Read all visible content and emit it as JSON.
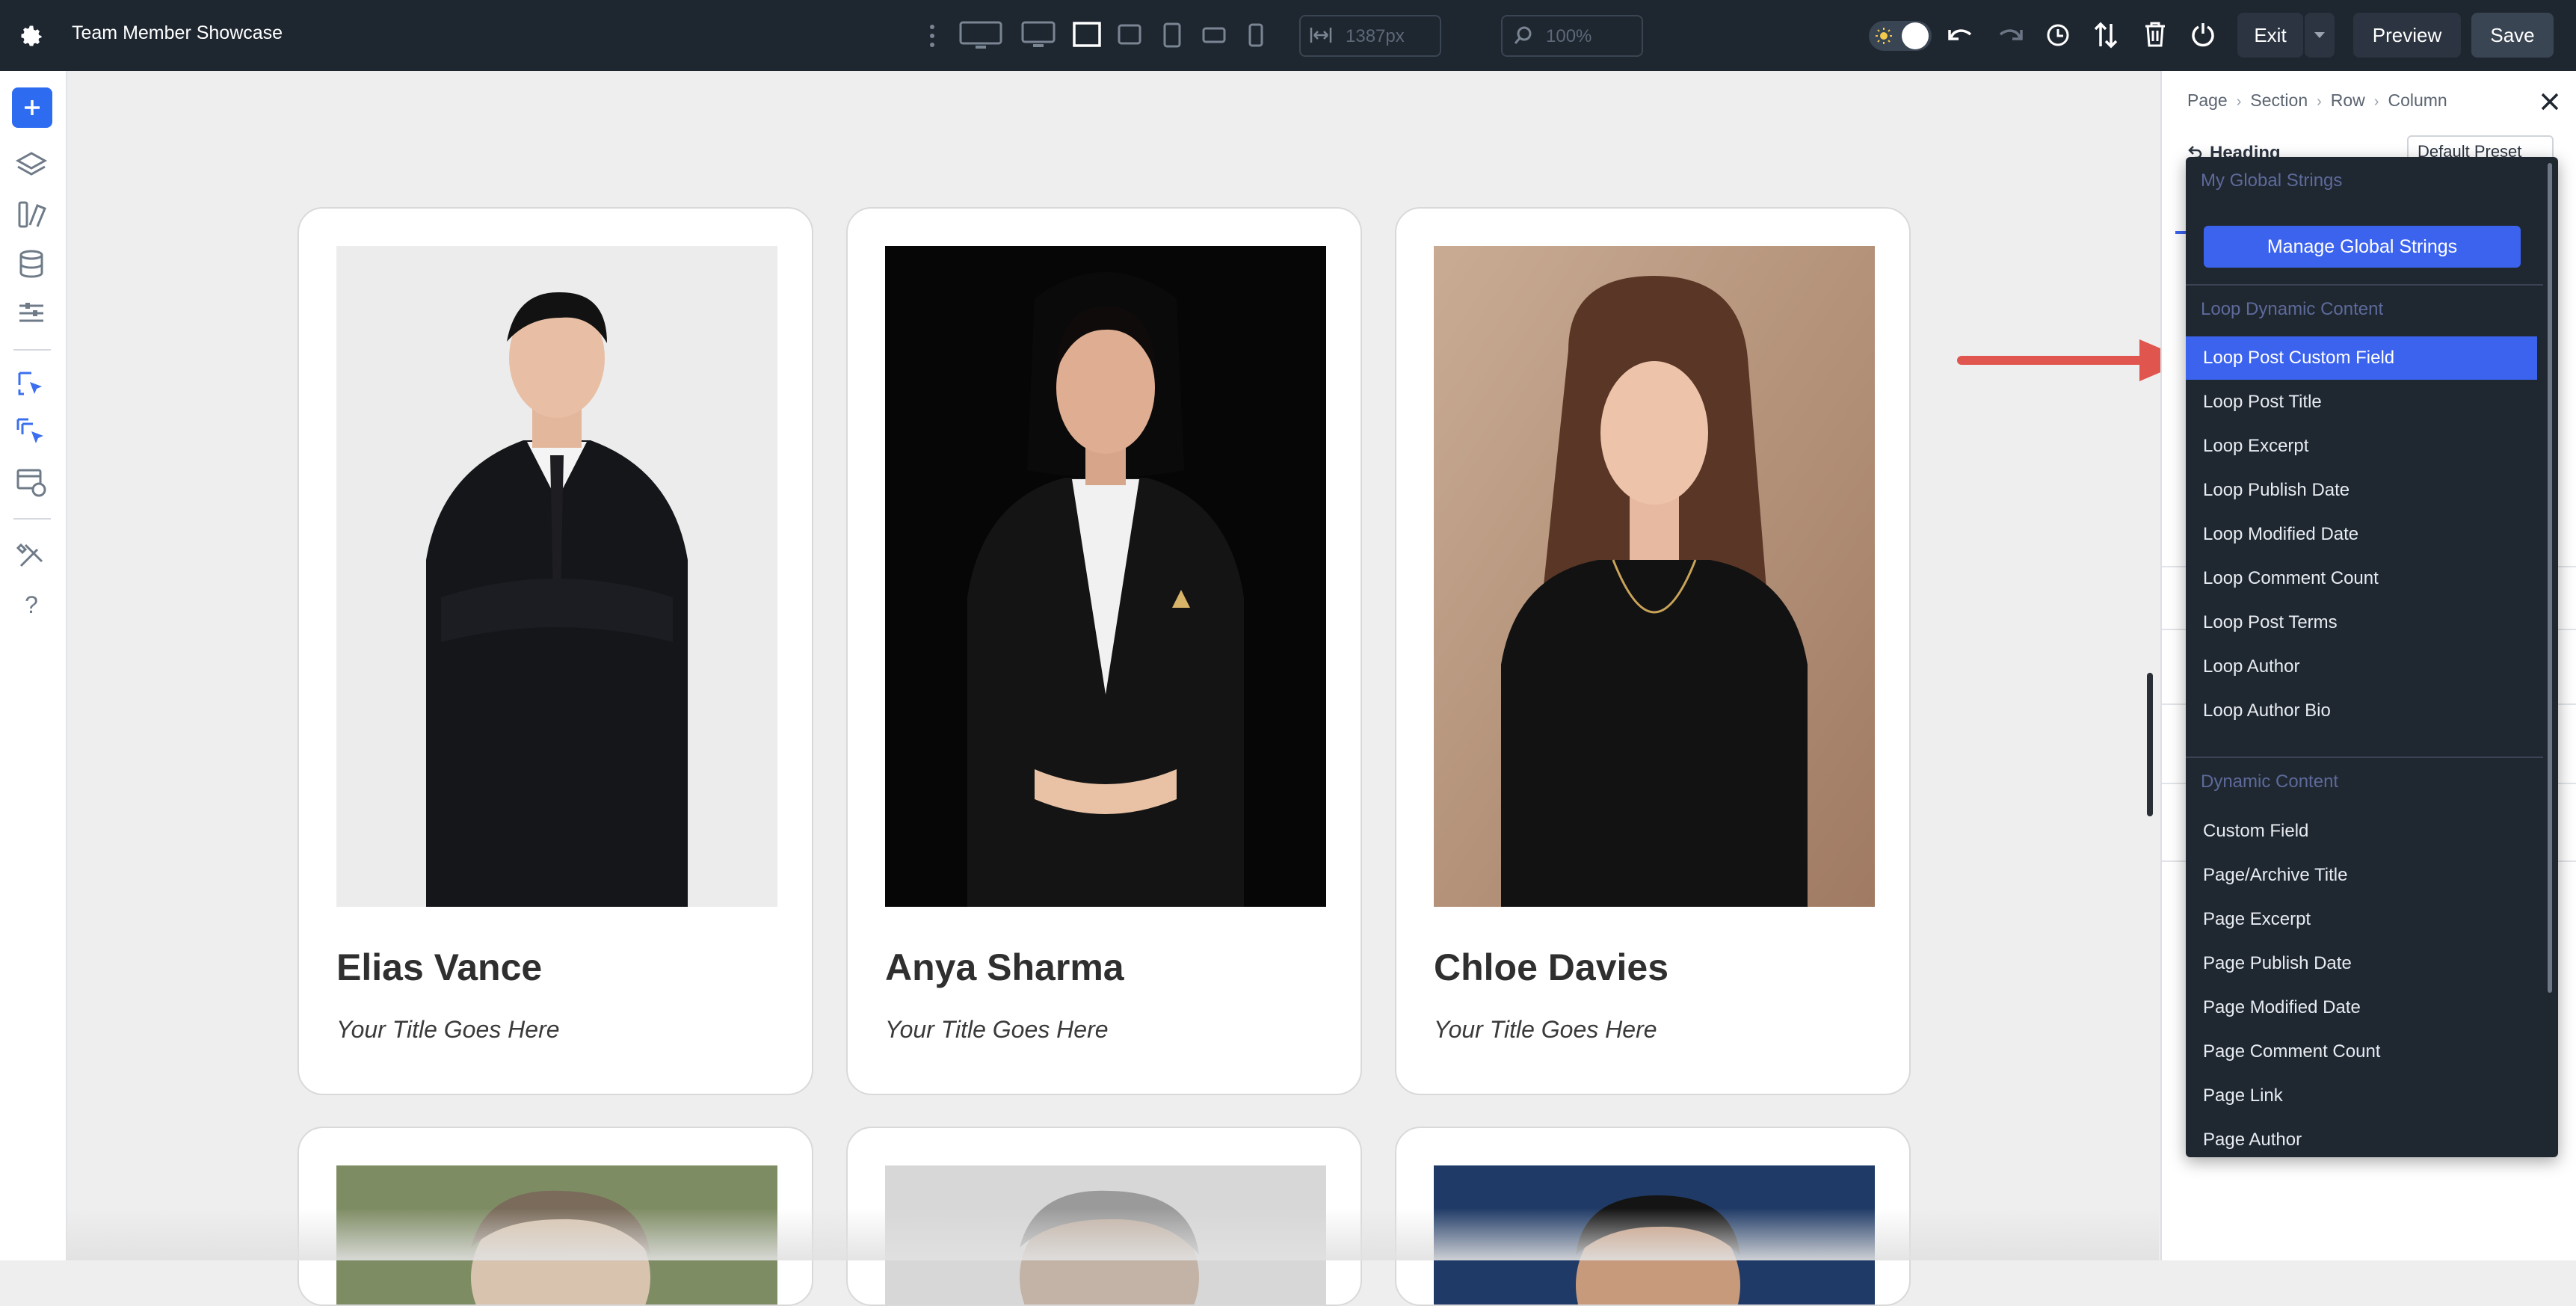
{
  "app": {
    "title": "Team Member Showcase"
  },
  "toolbar": {
    "width_value": "1387px",
    "zoom_value": "100%",
    "exit_label": "Exit",
    "preview_label": "Preview",
    "save_label": "Save"
  },
  "breadcrumb": [
    "Page",
    "Section",
    "Row",
    "Column"
  ],
  "panel": {
    "module_title": "Heading",
    "preset_label": "Default Preset"
  },
  "dropdown": {
    "global_header": "My Global Strings",
    "manage_label": "Manage Global Strings",
    "loop_header": "Loop Dynamic Content",
    "loop_items": [
      "Loop Post Custom Field",
      "Loop Post Title",
      "Loop Excerpt",
      "Loop Publish Date",
      "Loop Modified Date",
      "Loop Comment Count",
      "Loop Post Terms",
      "Loop Author",
      "Loop Author Bio"
    ],
    "dynamic_header": "Dynamic Content",
    "dynamic_items": [
      "Custom Field",
      "Page/Archive Title",
      "Page Excerpt",
      "Page Publish Date",
      "Page Modified Date",
      "Page Comment Count",
      "Page Link",
      "Page Author"
    ],
    "selected_item": "Loop Post Custom Field"
  },
  "cards": [
    {
      "name": "Elias Vance",
      "subtitle": "Your Title Goes Here"
    },
    {
      "name": "Anya Sharma",
      "subtitle": "Your Title Goes Here"
    },
    {
      "name": "Chloe Davies",
      "subtitle": "Your Title Goes Here"
    }
  ],
  "colors": {
    "accent": "#3c63ee",
    "topbar": "#1e2630",
    "annotation_arrow": "#e0564e",
    "save_button": "#3a4553"
  }
}
